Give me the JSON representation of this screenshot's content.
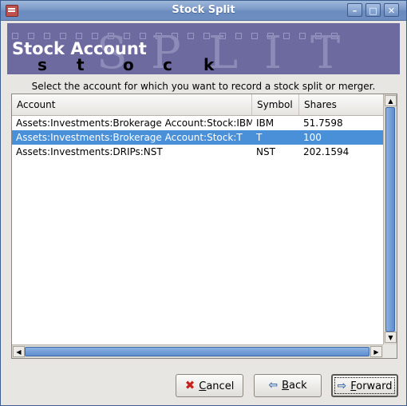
{
  "window": {
    "title": "Stock Split",
    "buttons": {
      "minimize": "–",
      "maximize": "□",
      "close": "✕"
    }
  },
  "banner": {
    "title": "Stock Account",
    "watermark_letters": [
      "S",
      "P",
      "L",
      "I",
      "T"
    ],
    "stock_letters": [
      "s",
      "t",
      "o",
      "c",
      "k"
    ]
  },
  "instruction": "Select the account for which you want to record a stock split or merger.",
  "table": {
    "columns": [
      "Account",
      "Symbol",
      "Shares"
    ],
    "rows": [
      {
        "account": "Assets:Investments:Brokerage Account:Stock:IBM",
        "symbol": "IBM",
        "shares": "51.7598",
        "selected": false
      },
      {
        "account": "Assets:Investments:Brokerage Account:Stock:T",
        "symbol": "T",
        "shares": "100",
        "selected": true
      },
      {
        "account": "Assets:Investments:DRIPs:NST",
        "symbol": "NST",
        "shares": "202.1594",
        "selected": false
      }
    ]
  },
  "buttons": {
    "cancel": {
      "mnemonic": "C",
      "rest": "ancel"
    },
    "back": {
      "mnemonic": "B",
      "rest": "ack"
    },
    "forward": {
      "mnemonic": "F",
      "rest": "orward"
    }
  },
  "colors": {
    "banner_bg": "#6d6aa0",
    "selection": "#4a90d9",
    "titlebar": "#7b99c8"
  },
  "icons": {
    "app": "stock-split-app-icon",
    "cancel": "red-x-icon",
    "back": "left-arrow-icon",
    "forward": "right-arrow-icon"
  }
}
